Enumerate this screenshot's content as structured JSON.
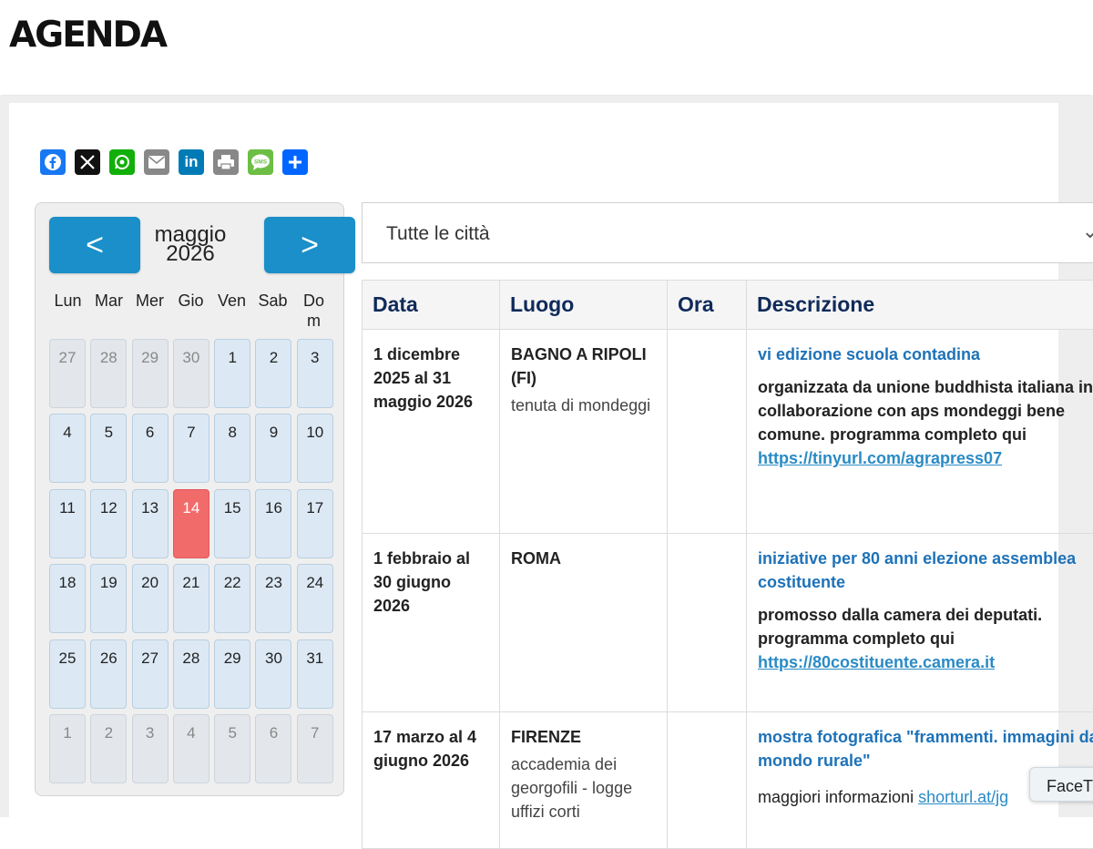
{
  "page": {
    "title": "AGENDA"
  },
  "share": [
    {
      "name": "facebook-icon",
      "color": "#1877f2"
    },
    {
      "name": "x-icon",
      "color": "#111111"
    },
    {
      "name": "whatsapp-icon",
      "color": "#12af0a"
    },
    {
      "name": "email-icon",
      "color": "#888888"
    },
    {
      "name": "linkedin-icon",
      "color": "#007bb5"
    },
    {
      "name": "print-icon",
      "color": "#888888"
    },
    {
      "name": "sms-icon",
      "color": "#6cbe45"
    },
    {
      "name": "share-icon",
      "color": "#0166ff"
    }
  ],
  "calendar": {
    "prev_label": "<",
    "next_label": ">",
    "month": "maggio",
    "year": "2026",
    "weekdays": [
      "Lun",
      "Mar",
      "Mer",
      "Gio",
      "Ven",
      "Sab",
      "Dom"
    ],
    "today": "14",
    "days": [
      {
        "n": "27",
        "other": true
      },
      {
        "n": "28",
        "other": true
      },
      {
        "n": "29",
        "other": true
      },
      {
        "n": "30",
        "other": true
      },
      {
        "n": "1"
      },
      {
        "n": "2"
      },
      {
        "n": "3"
      },
      {
        "n": "4"
      },
      {
        "n": "5"
      },
      {
        "n": "6"
      },
      {
        "n": "7"
      },
      {
        "n": "8"
      },
      {
        "n": "9"
      },
      {
        "n": "10"
      },
      {
        "n": "11"
      },
      {
        "n": "12"
      },
      {
        "n": "13"
      },
      {
        "n": "14",
        "today": true
      },
      {
        "n": "15"
      },
      {
        "n": "16"
      },
      {
        "n": "17"
      },
      {
        "n": "18"
      },
      {
        "n": "19"
      },
      {
        "n": "20"
      },
      {
        "n": "21"
      },
      {
        "n": "22"
      },
      {
        "n": "23"
      },
      {
        "n": "24"
      },
      {
        "n": "25"
      },
      {
        "n": "26"
      },
      {
        "n": "27"
      },
      {
        "n": "28"
      },
      {
        "n": "29"
      },
      {
        "n": "30"
      },
      {
        "n": "31"
      },
      {
        "n": "1",
        "other": true
      },
      {
        "n": "2",
        "other": true
      },
      {
        "n": "3",
        "other": true
      },
      {
        "n": "4",
        "other": true
      },
      {
        "n": "5",
        "other": true
      },
      {
        "n": "6",
        "other": true
      },
      {
        "n": "7",
        "other": true
      }
    ]
  },
  "filter": {
    "city_value": "Tutte le città"
  },
  "table": {
    "headers": [
      "Data",
      "Luogo",
      "Ora",
      "Descrizione"
    ],
    "rows": [
      {
        "date": "1 dicembre 2025 al 31 maggio 2026",
        "place": "BAGNO A RIPOLI (FI)",
        "venue": "tenuta di mondeggi",
        "time": "",
        "title": "vi edizione scuola contadina",
        "desc": "organizzata da unione buddhista italiana in collaborazione con aps mondeggi bene comune. programma completo qui",
        "link": "https://tinyurl.com/agrapress07"
      },
      {
        "date": "1 febbraio al 30 giugno 2026",
        "place": "ROMA",
        "venue": "",
        "time": "",
        "title": "iniziative per 80 anni elezione assemblea costituente",
        "desc": "promosso dalla camera dei deputati. programma completo qui",
        "link": "https://80costituente.camera.it"
      },
      {
        "date": "17 marzo al 4 giugno 2026",
        "place": "FIRENZE",
        "venue": "accademia dei georgofili - logge uffizi corti",
        "time": "",
        "title": "mostra fotografica \"frammenti. immagini dal mondo rurale\"",
        "desc": "maggiori informazioni",
        "link": "shorturl.at/jg"
      }
    ]
  },
  "widget": {
    "label": "FaceT"
  }
}
